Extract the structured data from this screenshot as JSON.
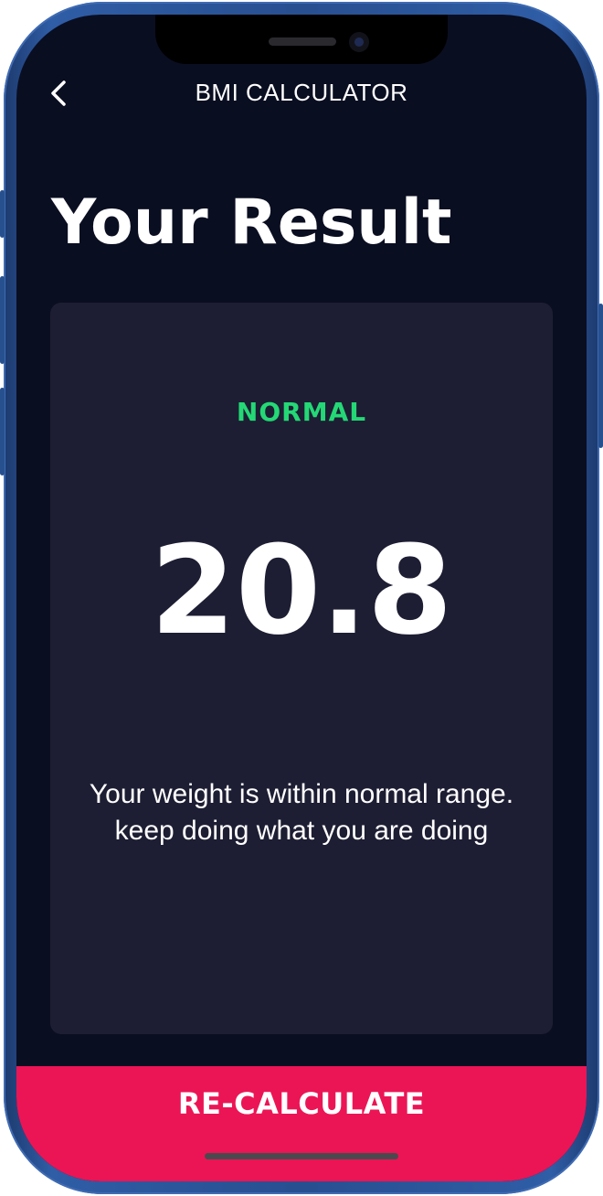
{
  "app_bar": {
    "title": "BMI CALCULATOR",
    "back_icon": "chevron-left-icon"
  },
  "heading": "Your Result",
  "result": {
    "status": "NORMAL",
    "bmi_value": "20.8",
    "message_line1": "Your weight is within normal range.",
    "message_line2": "keep doing what you are doing"
  },
  "recalculate_button": {
    "label": "RE-CALCULATE"
  },
  "colors": {
    "background": "#0a0e21",
    "card": "#1d1e33",
    "status_normal": "#24d876",
    "accent": "#eb1555",
    "text": "#ffffff"
  }
}
